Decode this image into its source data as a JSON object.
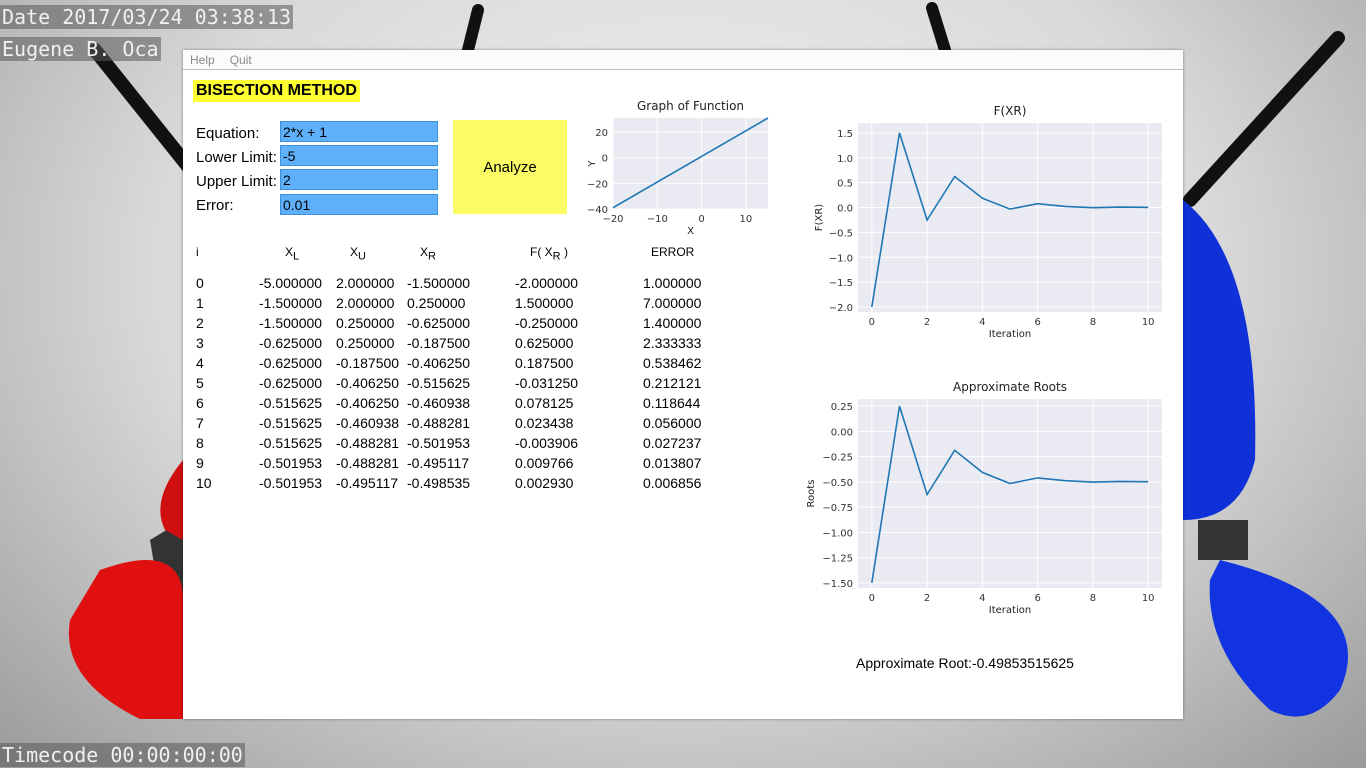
{
  "overlay": {
    "date": "Date 2017/03/24 03:38:13",
    "author": "Eugene B. Oca",
    "timecode": "Timecode 00:00:00:00"
  },
  "menu": [
    "Help",
    "Quit"
  ],
  "app": {
    "title": "BISECTION METHOD",
    "analyze_label": "Analyze"
  },
  "form": {
    "equation": {
      "label": "Equation:",
      "value": "2*x + 1"
    },
    "lower": {
      "label": "Lower Limit:",
      "value": "-5"
    },
    "upper": {
      "label": "Upper Limit:",
      "value": "2"
    },
    "error": {
      "label": "Error:",
      "value": "0.01"
    }
  },
  "table": {
    "headers": [
      {
        "label": "i"
      },
      {
        "label": "X",
        "sub": "L"
      },
      {
        "label": "X",
        "sub": "U"
      },
      {
        "label": "X",
        "sub": "R"
      },
      {
        "label": "F( X",
        "sub": "R",
        "suffix": " )"
      },
      {
        "label": "ERROR"
      }
    ],
    "rows": [
      [
        "0",
        "-5.000000",
        "2.000000",
        "-1.500000",
        "-2.000000",
        "1.000000"
      ],
      [
        "1",
        "-1.500000",
        "2.000000",
        "0.250000",
        "1.500000",
        "7.000000"
      ],
      [
        "2",
        "-1.500000",
        "0.250000",
        "-0.625000",
        "-0.250000",
        "1.400000"
      ],
      [
        "3",
        "-0.625000",
        "0.250000",
        "-0.187500",
        "0.625000",
        "2.333333"
      ],
      [
        "4",
        "-0.625000",
        "-0.187500",
        "-0.406250",
        "0.187500",
        "0.538462"
      ],
      [
        "5",
        "-0.625000",
        "-0.406250",
        "-0.515625",
        "-0.031250",
        "0.212121"
      ],
      [
        "6",
        "-0.515625",
        "-0.406250",
        "-0.460938",
        "0.078125",
        "0.118644"
      ],
      [
        "7",
        "-0.515625",
        "-0.460938",
        "-0.488281",
        "0.023438",
        "0.056000"
      ],
      [
        "8",
        "-0.515625",
        "-0.488281",
        "-0.501953",
        "-0.003906",
        "0.027237"
      ],
      [
        "9",
        "-0.501953",
        "-0.488281",
        "-0.495117",
        "0.009766",
        "0.013807"
      ],
      [
        "10",
        "-0.501953",
        "-0.495117",
        "-0.498535",
        "0.002930",
        "0.006856"
      ]
    ]
  },
  "result": {
    "label": "Approximate Root:",
    "value": "-0.49853515625"
  },
  "colors": {
    "input_bg": "#5fb0fb",
    "button_bg": "#fbfb66",
    "title_bg": "#ffff33",
    "line": "#1f77b4",
    "plot_bg": "#eaeaf2"
  },
  "chart_data": [
    {
      "type": "line",
      "title": "Graph of Function",
      "xlabel": "X",
      "ylabel": "Y",
      "x": [
        -20,
        15
      ],
      "y": [
        -39,
        31
      ],
      "xlim": [
        -20,
        15
      ],
      "ylim": [
        -40,
        31
      ],
      "xticks": [
        -20,
        -10,
        0,
        10
      ],
      "yticks": [
        -40,
        -20,
        0,
        20
      ],
      "grid": true
    },
    {
      "type": "line",
      "title": "F(XR)",
      "xlabel": "Iteration",
      "ylabel": "F(XR)",
      "x": [
        0,
        1,
        2,
        3,
        4,
        5,
        6,
        7,
        8,
        9,
        10
      ],
      "y": [
        -2.0,
        1.5,
        -0.25,
        0.625,
        0.1875,
        -0.03125,
        0.078125,
        0.023438,
        -0.003906,
        0.009766,
        0.00293
      ],
      "xlim": [
        -0.5,
        10.5
      ],
      "ylim": [
        -2.1,
        1.7
      ],
      "xticks": [
        0,
        2,
        4,
        6,
        8,
        10
      ],
      "yticks": [
        -2.0,
        -1.5,
        -1.0,
        -0.5,
        0.0,
        0.5,
        1.0,
        1.5
      ],
      "grid": true
    },
    {
      "type": "line",
      "title": "Approximate Roots",
      "xlabel": "Iteration",
      "ylabel": "Roots",
      "x": [
        0,
        1,
        2,
        3,
        4,
        5,
        6,
        7,
        8,
        9,
        10
      ],
      "y": [
        -1.5,
        0.25,
        -0.625,
        -0.1875,
        -0.40625,
        -0.515625,
        -0.460938,
        -0.488281,
        -0.501953,
        -0.495117,
        -0.498535
      ],
      "xlim": [
        -0.5,
        10.5
      ],
      "ylim": [
        -1.55,
        0.32
      ],
      "xticks": [
        0,
        2,
        4,
        6,
        8,
        10
      ],
      "yticks": [
        -1.5,
        -1.25,
        -1.0,
        -0.75,
        -0.5,
        -0.25,
        0.0,
        0.25
      ],
      "grid": true
    }
  ]
}
